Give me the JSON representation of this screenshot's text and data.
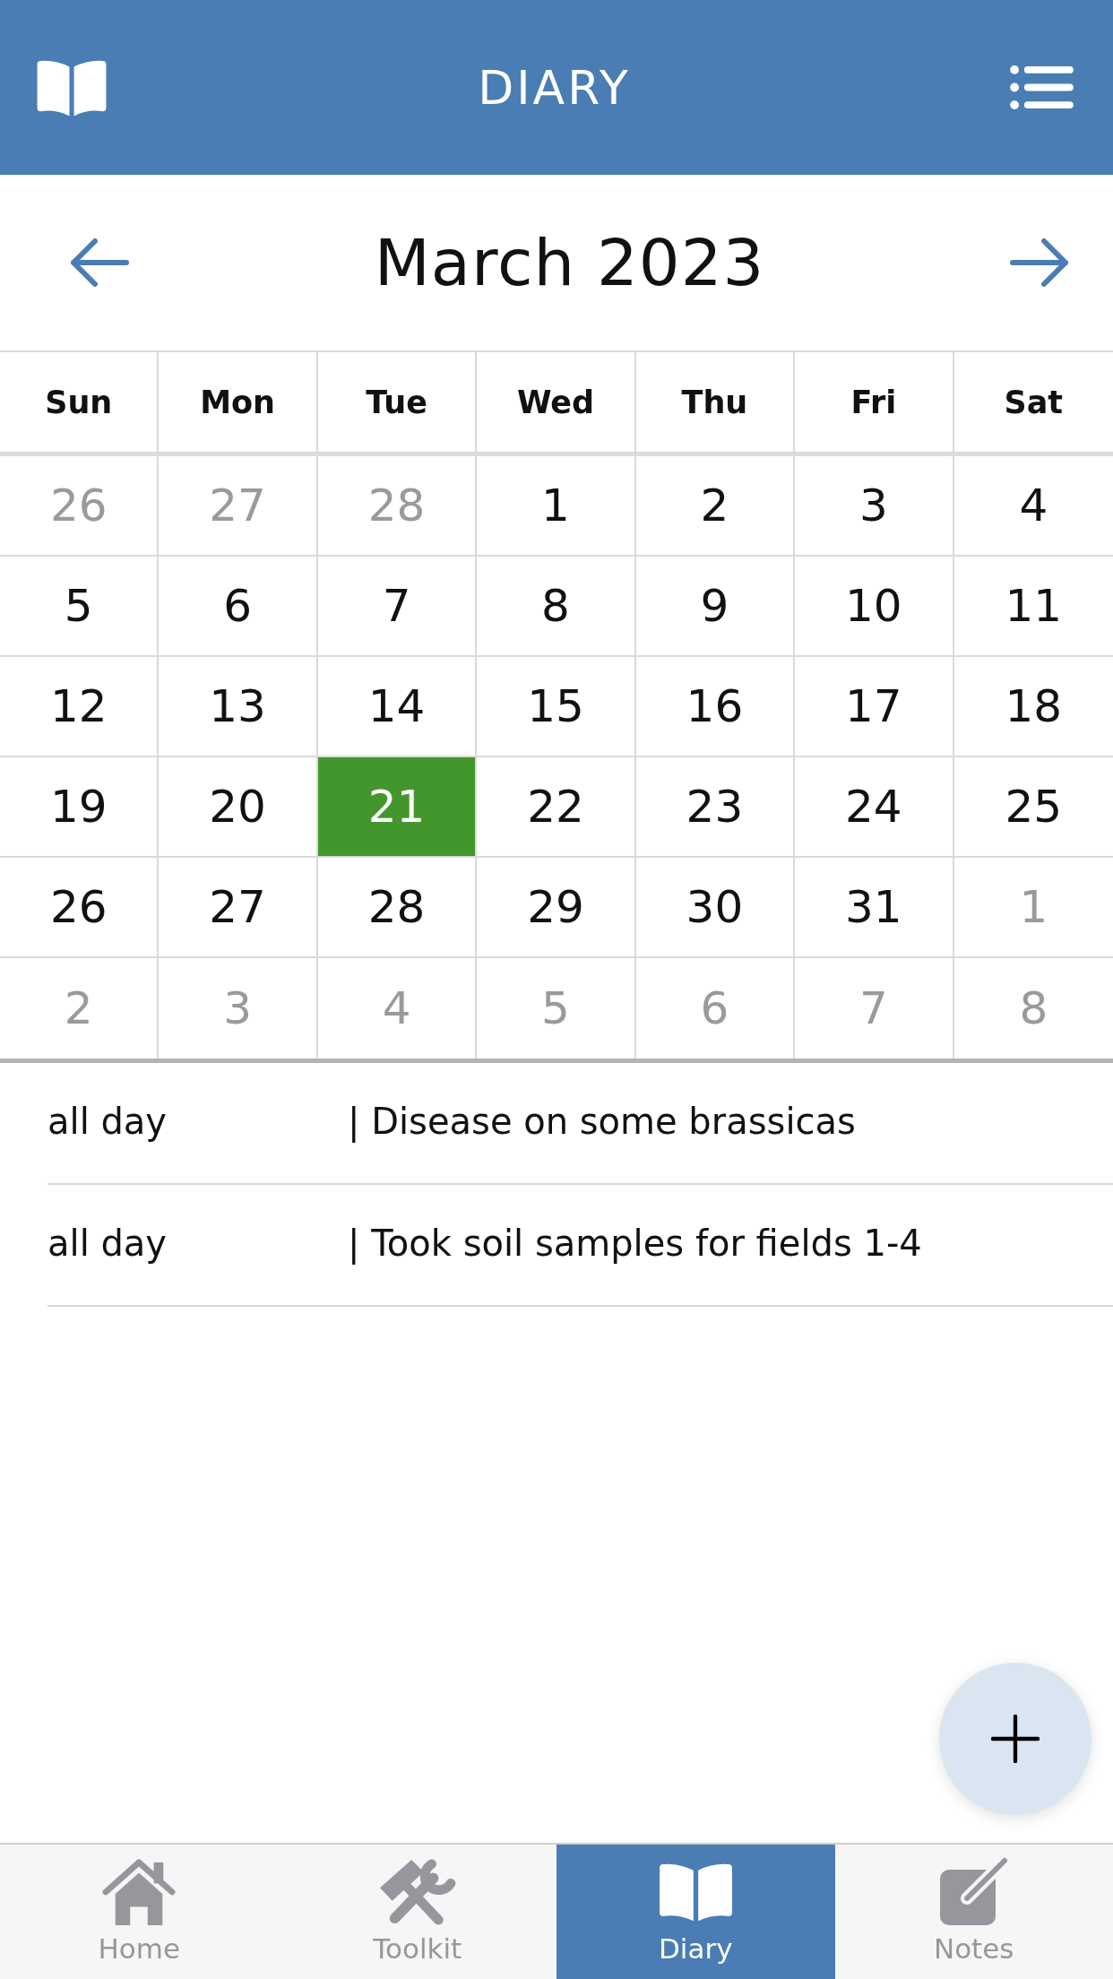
{
  "app_bar": {
    "title": "DIARY"
  },
  "month_nav": {
    "title": "March 2023"
  },
  "calendar": {
    "weekdays": [
      "Sun",
      "Mon",
      "Tue",
      "Wed",
      "Thu",
      "Fri",
      "Sat"
    ],
    "weeks": [
      [
        {
          "day": "26",
          "muted": true,
          "selected": false
        },
        {
          "day": "27",
          "muted": true,
          "selected": false
        },
        {
          "day": "28",
          "muted": true,
          "selected": false
        },
        {
          "day": "1",
          "muted": false,
          "selected": false
        },
        {
          "day": "2",
          "muted": false,
          "selected": false
        },
        {
          "day": "3",
          "muted": false,
          "selected": false
        },
        {
          "day": "4",
          "muted": false,
          "selected": false
        }
      ],
      [
        {
          "day": "5",
          "muted": false,
          "selected": false
        },
        {
          "day": "6",
          "muted": false,
          "selected": false
        },
        {
          "day": "7",
          "muted": false,
          "selected": false
        },
        {
          "day": "8",
          "muted": false,
          "selected": false
        },
        {
          "day": "9",
          "muted": false,
          "selected": false
        },
        {
          "day": "10",
          "muted": false,
          "selected": false
        },
        {
          "day": "11",
          "muted": false,
          "selected": false
        }
      ],
      [
        {
          "day": "12",
          "muted": false,
          "selected": false
        },
        {
          "day": "13",
          "muted": false,
          "selected": false
        },
        {
          "day": "14",
          "muted": false,
          "selected": false
        },
        {
          "day": "15",
          "muted": false,
          "selected": false
        },
        {
          "day": "16",
          "muted": false,
          "selected": false
        },
        {
          "day": "17",
          "muted": false,
          "selected": false
        },
        {
          "day": "18",
          "muted": false,
          "selected": false
        }
      ],
      [
        {
          "day": "19",
          "muted": false,
          "selected": false
        },
        {
          "day": "20",
          "muted": false,
          "selected": false
        },
        {
          "day": "21",
          "muted": false,
          "selected": true
        },
        {
          "day": "22",
          "muted": false,
          "selected": false
        },
        {
          "day": "23",
          "muted": false,
          "selected": false
        },
        {
          "day": "24",
          "muted": false,
          "selected": false
        },
        {
          "day": "25",
          "muted": false,
          "selected": false
        }
      ],
      [
        {
          "day": "26",
          "muted": false,
          "selected": false
        },
        {
          "day": "27",
          "muted": false,
          "selected": false
        },
        {
          "day": "28",
          "muted": false,
          "selected": false
        },
        {
          "day": "29",
          "muted": false,
          "selected": false
        },
        {
          "day": "30",
          "muted": false,
          "selected": false
        },
        {
          "day": "31",
          "muted": false,
          "selected": false
        },
        {
          "day": "1",
          "muted": true,
          "selected": false
        }
      ],
      [
        {
          "day": "2",
          "muted": true,
          "selected": false
        },
        {
          "day": "3",
          "muted": true,
          "selected": false
        },
        {
          "day": "4",
          "muted": true,
          "selected": false
        },
        {
          "day": "5",
          "muted": true,
          "selected": false
        },
        {
          "day": "6",
          "muted": true,
          "selected": false
        },
        {
          "day": "7",
          "muted": true,
          "selected": false
        },
        {
          "day": "8",
          "muted": true,
          "selected": false
        }
      ]
    ]
  },
  "events": [
    {
      "time": "all day",
      "title": "| Disease on some brassicas"
    },
    {
      "time": "all day",
      "title": "| Took soil samples for fields 1-4"
    }
  ],
  "bottom_nav": [
    {
      "label": "Home",
      "kind": "home",
      "selected": false
    },
    {
      "label": "Toolkit",
      "kind": "toolkit",
      "selected": false
    },
    {
      "label": "Diary",
      "kind": "diary",
      "selected": true
    },
    {
      "label": "Notes",
      "kind": "notes",
      "selected": false
    }
  ]
}
